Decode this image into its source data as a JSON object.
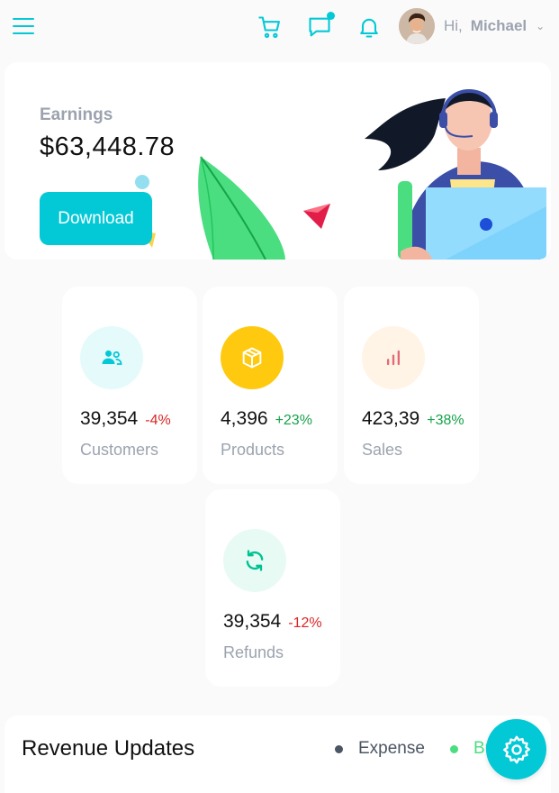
{
  "header": {
    "menu_icon": "hamburger-menu-icon",
    "cart_icon": "shopping-cart-icon",
    "chat_icon": "chat-icon",
    "bell_icon": "notification-bell-icon",
    "greeting": "Hi,",
    "user_name": "Michael"
  },
  "earnings": {
    "label": "Earnings",
    "value": "$63,448.78",
    "button_label": "Download"
  },
  "stats": [
    {
      "icon": "customers-icon",
      "value": "39,354",
      "change": "-4%",
      "label": "Customers",
      "icon_bg": "#e5fafb",
      "icon_color": "#03c9d7",
      "trend": "neg"
    },
    {
      "icon": "box-icon",
      "value": "4,396",
      "change": "+23%",
      "label": "Products",
      "icon_bg": "#fec90f",
      "icon_color": "#ffffff",
      "trend": "pos"
    },
    {
      "icon": "bar-chart-icon",
      "value": "423,39",
      "change": "+38%",
      "label": "Sales",
      "icon_bg": "#fff4e5",
      "icon_color": "#e46a76",
      "trend": "pos"
    },
    {
      "icon": "refresh-icon",
      "value": "39,354",
      "change": "-12%",
      "label": "Refunds",
      "icon_bg": "#e8faf4",
      "icon_color": "#00c292",
      "trend": "neg"
    }
  ],
  "revenue": {
    "title": "Revenue Updates",
    "legend": [
      {
        "label": "Expense",
        "color": "#4b5563"
      },
      {
        "label": "Budget",
        "color": "#4ade80"
      }
    ]
  },
  "colors": {
    "accent": "#03c9d7",
    "negative": "#dc2626",
    "positive": "#16a34a"
  },
  "settings_icon": "gear-icon"
}
